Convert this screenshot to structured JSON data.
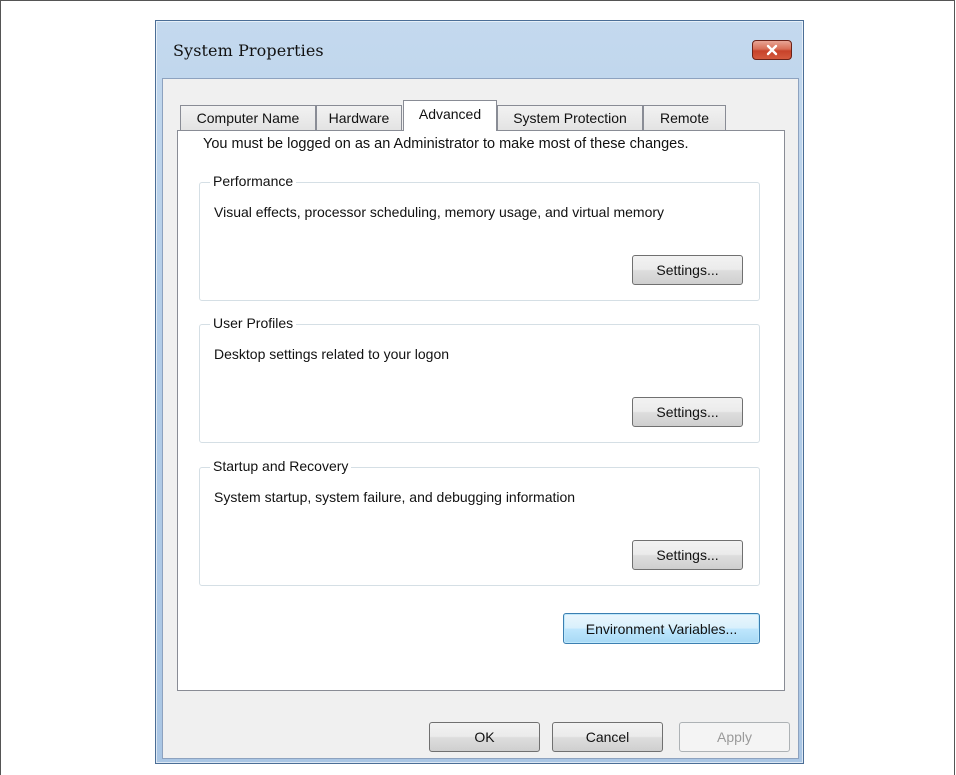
{
  "window": {
    "title": "System Properties",
    "close_icon": "close-x-icon",
    "close_color": "#c7422a"
  },
  "tabs": [
    {
      "label": "Computer Name",
      "active": false
    },
    {
      "label": "Hardware",
      "active": false
    },
    {
      "label": "Advanced",
      "active": true
    },
    {
      "label": "System Protection",
      "active": false
    },
    {
      "label": "Remote",
      "active": false
    }
  ],
  "advanced": {
    "admin_note": "You must be logged on as an Administrator to make most of these changes.",
    "performance": {
      "title": "Performance",
      "description": "Visual effects, processor scheduling, memory usage, and virtual memory",
      "button": "Settings..."
    },
    "user_profiles": {
      "title": "User Profiles",
      "description": "Desktop settings related to your logon",
      "button": "Settings..."
    },
    "startup_recovery": {
      "title": "Startup and Recovery",
      "description": "System startup, system failure, and debugging information",
      "button": "Settings..."
    },
    "env_vars_button": "Environment Variables..."
  },
  "footer": {
    "ok": "OK",
    "cancel": "Cancel",
    "apply": "Apply"
  },
  "colors": {
    "title_bar": "#b3cde8",
    "focus_accent": "#3c7fb1"
  }
}
